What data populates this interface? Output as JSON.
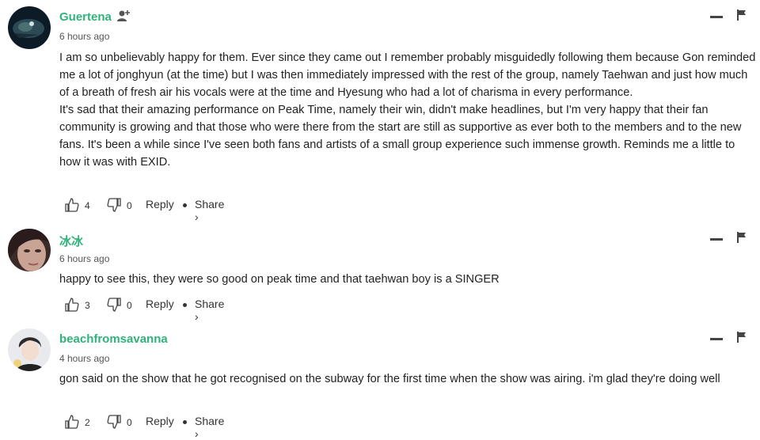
{
  "comments": [
    {
      "username": "Guertena",
      "time": "6 hours ago",
      "paragraphs": [
        "I am so unbelievably happy for them. Ever since they came out I remember probably misguidedly following them because Gon reminded me a lot of jonghyun (at the time) but I was then immediately impressed with the rest of the group, namely Taehwan and just how much of a breath of fresh air his vocals were at the time and Hyesung who had a lot of charisma in every performance.",
        "It's sad that their amazing performance on Peak Time, namely their win, didn't make headlines, but I'm very happy that their fan community is growing and that those who were there from the start are still as supportive as ever both to the members and to the new fans. It's been a while since I've seen both fans and artists of a small group experience such immense growth. Reminds me a little to how it was with EXID."
      ],
      "likes": "4",
      "dislikes": "0",
      "reply": "Reply",
      "share": "Share ›"
    },
    {
      "username": "冰冰",
      "time": "6 hours ago",
      "paragraphs": [
        "happy to see this, they were so good on peak time and that taehwan boy is a SINGER"
      ],
      "likes": "3",
      "dislikes": "0",
      "reply": "Reply",
      "share": "Share ›"
    },
    {
      "username": "beachfromsavanna",
      "time": "4 hours ago",
      "paragraphs": [
        "gon said on the show that he got recognised on the subway for the first time when the show was airing. i'm glad they're doing well"
      ],
      "likes": "2",
      "dislikes": "0",
      "reply": "Reply",
      "share": "Share ›"
    }
  ],
  "colors": {
    "username": "#2fb37a",
    "text": "#222222",
    "meta": "#555555"
  }
}
